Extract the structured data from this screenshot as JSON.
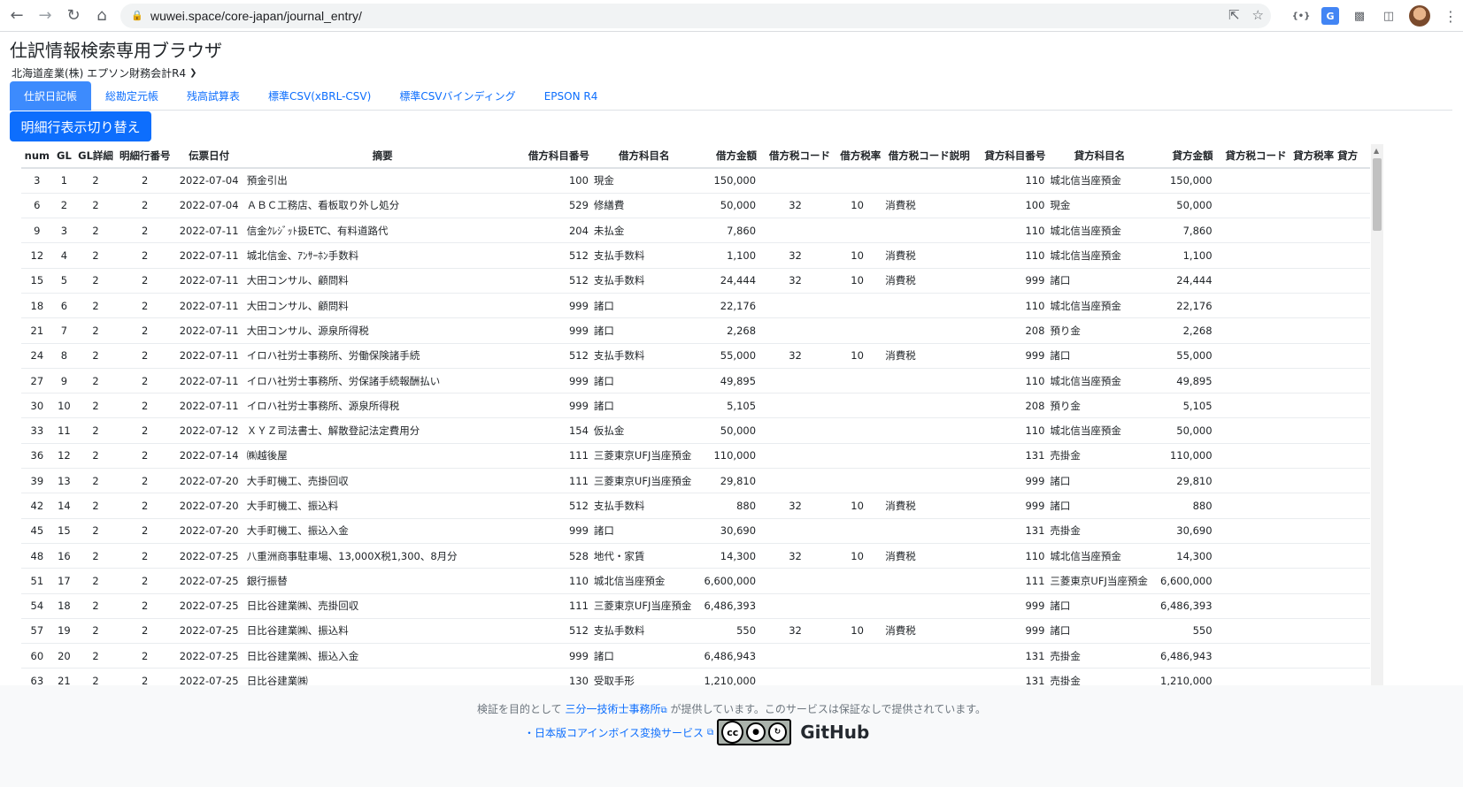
{
  "browser": {
    "url": "wuwei.space/core-japan/journal_entry/"
  },
  "page": {
    "title": "仕訳情報検索専用ブラウザ",
    "company": "北海道産業(株) エプソン財務会計R4",
    "detail_button": "明細行表示切り替え"
  },
  "tabs": [
    {
      "label": "仕訳日記帳",
      "active": true
    },
    {
      "label": "総勘定元帳",
      "active": false
    },
    {
      "label": "残高試算表",
      "active": false
    },
    {
      "label": "標準CSV(xBRL-CSV)",
      "active": false
    },
    {
      "label": "標準CSVバインディング",
      "active": false
    },
    {
      "label": "EPSON R4",
      "active": false
    }
  ],
  "table": {
    "headers": [
      "num",
      "GL",
      "GL詳細",
      "明細行番号",
      "伝票日付",
      "摘要",
      "借方科目番号",
      "借方科目名",
      "借方金額",
      "借方税コード",
      "借方税率",
      "借方税コード説明",
      "貸方科目番号",
      "貸方科目名",
      "貸方金額",
      "貸方税コード",
      "貸方税率",
      "貸方"
    ],
    "rows": [
      [
        "3",
        "1",
        "2",
        "2",
        "2022-07-04",
        "預金引出",
        "100",
        "現金",
        "150,000",
        "",
        "",
        "",
        "110",
        "城北信当座預金",
        "150,000",
        "",
        "",
        ""
      ],
      [
        "6",
        "2",
        "2",
        "2",
        "2022-07-04",
        "ＡＢＣ工務店、看板取り外し処分",
        "529",
        "修繕費",
        "50,000",
        "32",
        "10",
        "消費税",
        "100",
        "現金",
        "50,000",
        "",
        "",
        ""
      ],
      [
        "9",
        "3",
        "2",
        "2",
        "2022-07-11",
        "信金ｸﾚｼﾞｯﾄ扱ETC、有料道路代",
        "204",
        "未払金",
        "7,860",
        "",
        "",
        "",
        "110",
        "城北信当座預金",
        "7,860",
        "",
        "",
        ""
      ],
      [
        "12",
        "4",
        "2",
        "2",
        "2022-07-11",
        "城北信金、ｱﾝｻｰﾎﾝ手数料",
        "512",
        "支払手数料",
        "1,100",
        "32",
        "10",
        "消費税",
        "110",
        "城北信当座預金",
        "1,100",
        "",
        "",
        ""
      ],
      [
        "15",
        "5",
        "2",
        "2",
        "2022-07-11",
        "大田コンサル、顧問料",
        "512",
        "支払手数料",
        "24,444",
        "32",
        "10",
        "消費税",
        "999",
        "諸口",
        "24,444",
        "",
        "",
        ""
      ],
      [
        "18",
        "6",
        "2",
        "2",
        "2022-07-11",
        "大田コンサル、顧問料",
        "999",
        "諸口",
        "22,176",
        "",
        "",
        "",
        "110",
        "城北信当座預金",
        "22,176",
        "",
        "",
        ""
      ],
      [
        "21",
        "7",
        "2",
        "2",
        "2022-07-11",
        "大田コンサル、源泉所得税",
        "999",
        "諸口",
        "2,268",
        "",
        "",
        "",
        "208",
        "預り金",
        "2,268",
        "",
        "",
        ""
      ],
      [
        "24",
        "8",
        "2",
        "2",
        "2022-07-11",
        "イロハ社労士事務所、労働保険諸手続",
        "512",
        "支払手数料",
        "55,000",
        "32",
        "10",
        "消費税",
        "999",
        "諸口",
        "55,000",
        "",
        "",
        ""
      ],
      [
        "27",
        "9",
        "2",
        "2",
        "2022-07-11",
        "イロハ社労士事務所、労保諸手続報酬払い",
        "999",
        "諸口",
        "49,895",
        "",
        "",
        "",
        "110",
        "城北信当座預金",
        "49,895",
        "",
        "",
        ""
      ],
      [
        "30",
        "10",
        "2",
        "2",
        "2022-07-11",
        "イロハ社労士事務所、源泉所得税",
        "999",
        "諸口",
        "5,105",
        "",
        "",
        "",
        "208",
        "預り金",
        "5,105",
        "",
        "",
        ""
      ],
      [
        "33",
        "11",
        "2",
        "2",
        "2022-07-12",
        "ＸＹＺ司法書士、解散登記法定費用分",
        "154",
        "仮払金",
        "50,000",
        "",
        "",
        "",
        "110",
        "城北信当座預金",
        "50,000",
        "",
        "",
        ""
      ],
      [
        "36",
        "12",
        "2",
        "2",
        "2022-07-14",
        "㈱越後屋",
        "111",
        "三菱東京UFJ当座預金",
        "110,000",
        "",
        "",
        "",
        "131",
        "売掛金",
        "110,000",
        "",
        "",
        ""
      ],
      [
        "39",
        "13",
        "2",
        "2",
        "2022-07-20",
        "大手町機工、売掛回収",
        "111",
        "三菱東京UFJ当座預金",
        "29,810",
        "",
        "",
        "",
        "999",
        "諸口",
        "29,810",
        "",
        "",
        ""
      ],
      [
        "42",
        "14",
        "2",
        "2",
        "2022-07-20",
        "大手町機工、振込料",
        "512",
        "支払手数料",
        "880",
        "32",
        "10",
        "消費税",
        "999",
        "諸口",
        "880",
        "",
        "",
        ""
      ],
      [
        "45",
        "15",
        "2",
        "2",
        "2022-07-20",
        "大手町機工、振込入金",
        "999",
        "諸口",
        "30,690",
        "",
        "",
        "",
        "131",
        "売掛金",
        "30,690",
        "",
        "",
        ""
      ],
      [
        "48",
        "16",
        "2",
        "2",
        "2022-07-25",
        "八重洲商事駐車場、13,000X税1,300、8月分",
        "528",
        "地代・家賃",
        "14,300",
        "32",
        "10",
        "消費税",
        "110",
        "城北信当座預金",
        "14,300",
        "",
        "",
        ""
      ],
      [
        "51",
        "17",
        "2",
        "2",
        "2022-07-25",
        "銀行振替",
        "110",
        "城北信当座預金",
        "6,600,000",
        "",
        "",
        "",
        "111",
        "三菱東京UFJ当座預金",
        "6,600,000",
        "",
        "",
        ""
      ],
      [
        "54",
        "18",
        "2",
        "2",
        "2022-07-25",
        "日比谷建業㈱、売掛回収",
        "111",
        "三菱東京UFJ当座預金",
        "6,486,393",
        "",
        "",
        "",
        "999",
        "諸口",
        "6,486,393",
        "",
        "",
        ""
      ],
      [
        "57",
        "19",
        "2",
        "2",
        "2022-07-25",
        "日比谷建業㈱、振込料",
        "512",
        "支払手数料",
        "550",
        "32",
        "10",
        "消費税",
        "999",
        "諸口",
        "550",
        "",
        "",
        ""
      ],
      [
        "60",
        "20",
        "2",
        "2",
        "2022-07-25",
        "日比谷建業㈱、振込入金",
        "999",
        "諸口",
        "6,486,943",
        "",
        "",
        "",
        "131",
        "売掛金",
        "6,486,943",
        "",
        "",
        ""
      ],
      [
        "63",
        "21",
        "2",
        "2",
        "2022-07-25",
        "日比谷建業㈱",
        "130",
        "受取手形",
        "1,210,000",
        "",
        "",
        "",
        "131",
        "売掛金",
        "1,210,000",
        "",
        "",
        ""
      ]
    ]
  },
  "footer": {
    "line1_prefix": "検証を目的として",
    "line1_link": "三分一技術士事務所",
    "line1_suffix": "が提供しています。このサービスは保証なしで提供されています。",
    "line2_link": "・日本版コアインボイス変換サービス",
    "cc_label": "BY SA",
    "github": "GitHub"
  }
}
